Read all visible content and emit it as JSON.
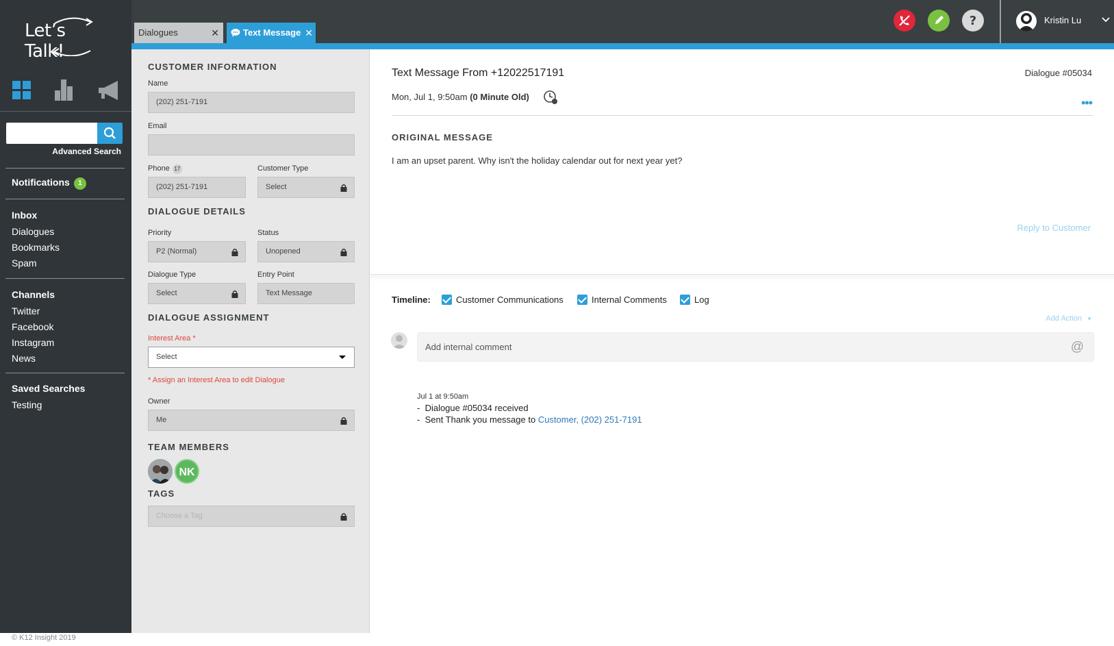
{
  "app": {
    "logo_text": "Let’s Talk!",
    "copyright": "© K12 Insight 2019"
  },
  "sidebar": {
    "search_placeholder": "",
    "advanced_search": "Advanced Search",
    "notifications_label": "Notifications",
    "notifications_count": "1",
    "sections": [
      {
        "title": "Inbox",
        "items": [
          "Dialogues",
          "Bookmarks",
          "Spam"
        ]
      },
      {
        "title": "Channels",
        "items": [
          "Twitter",
          "Facebook",
          "Instagram",
          "News"
        ]
      },
      {
        "title": "Saved Searches",
        "items": [
          "Testing"
        ]
      }
    ]
  },
  "tabs": [
    {
      "label": "Dialogues",
      "active": false
    },
    {
      "label": "Text Message",
      "active": true
    }
  ],
  "user": {
    "name": "Kristin Lu"
  },
  "colors": {
    "accent": "#2e9ed8",
    "sidebar_bg": "#2f3538",
    "topbar_bg": "#3a3f42",
    "danger": "#e0263a",
    "success": "#7ac142"
  },
  "panel": {
    "customer_info": {
      "title": "CUSTOMER INFORMATION",
      "name_label": "Name",
      "name_value": "(202) 251-7191",
      "email_label": "Email",
      "email_value": "",
      "phone_label": "Phone",
      "phone_count": "17",
      "phone_value": "(202) 251-7191",
      "customer_type_label": "Customer Type",
      "customer_type_value": "Select"
    },
    "dialogue_details": {
      "title": "DIALOGUE DETAILS",
      "priority_label": "Priority",
      "priority_value": "P2 (Normal)",
      "status_label": "Status",
      "status_value": "Unopened",
      "type_label": "Dialogue Type",
      "type_value": "Select",
      "entry_label": "Entry Point",
      "entry_value": "Text Message"
    },
    "assignment": {
      "title": "DIALOGUE ASSIGNMENT",
      "interest_label": "Interest Area *",
      "interest_value": "Select",
      "warning": "* Assign an Interest Area to edit Dialogue",
      "owner_label": "Owner",
      "owner_value": "Me"
    },
    "team": {
      "title": "TEAM MEMBERS",
      "members": [
        "",
        "NK"
      ]
    },
    "tags": {
      "title": "TAGS",
      "placeholder": "Choose a Tag"
    }
  },
  "message": {
    "title": "Text Message From +12022517191",
    "dialogue_id": "Dialogue #05034",
    "date": "Mon, Jul 1, 9:50am",
    "age": "(0 Minute Old)",
    "original_title": "ORIGINAL MESSAGE",
    "original_body": "I am an upset parent. Why isn't the holiday calendar out for next year yet?",
    "reply_label": "Reply to Customer"
  },
  "timeline": {
    "label": "Timeline:",
    "filters": [
      {
        "label": "Customer Communications",
        "checked": true
      },
      {
        "label": "Internal Comments",
        "checked": true
      },
      {
        "label": "Log",
        "checked": true
      }
    ],
    "add_action": "Add Action",
    "comment_placeholder": "Add internal comment",
    "log": {
      "date": "Jul 1 at 9:50am",
      "line1": "Dialogue #05034 received",
      "line2_prefix": "Sent Thank you message to",
      "line2_link": "Customer, (202) 251-7191"
    }
  }
}
